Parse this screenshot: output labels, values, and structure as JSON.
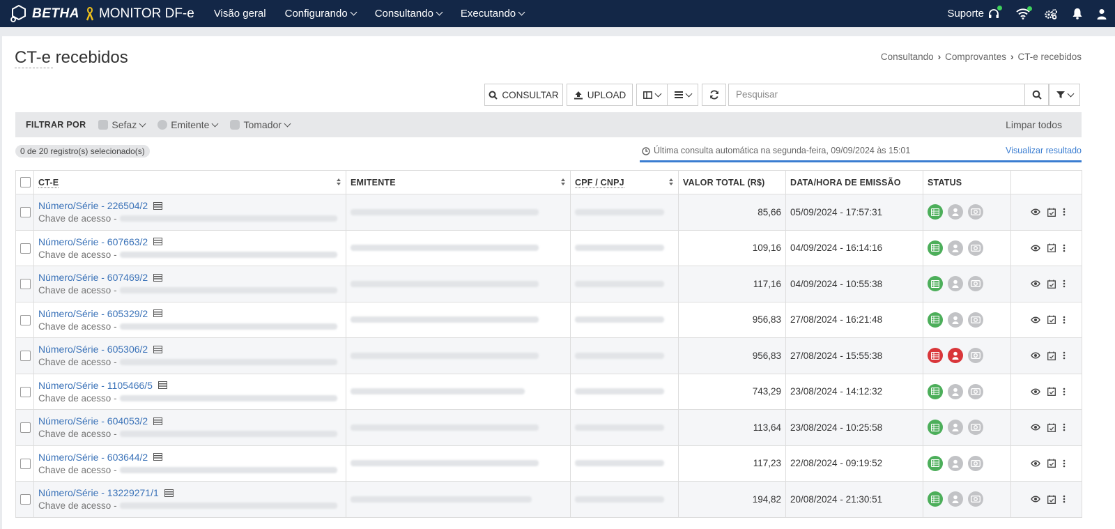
{
  "topbar": {
    "brand": "BETHA",
    "app": "MONITOR DF-e",
    "nav": [
      "Visão geral",
      "Configurando",
      "Consultando",
      "Executando"
    ],
    "support": "Suporte"
  },
  "page": {
    "title": "CT-e recebidos",
    "breadcrumb": [
      "Consultando",
      "Comprovantes",
      "CT-e recebidos"
    ]
  },
  "toolbar": {
    "consultar": "CONSULTAR",
    "upload": "UPLOAD",
    "search_placeholder": "Pesquisar"
  },
  "filters": {
    "label": "FILTRAR POR",
    "items": [
      "Sefaz",
      "Emitente",
      "Tomador"
    ],
    "clear": "Limpar todos"
  },
  "selection": "0 de 20 registro(s) selecionado(s)",
  "last_query": "Última consulta automática na segunda-feira, 09/09/2024 às 15:01",
  "view_result": "Visualizar resultado",
  "table": {
    "headers": [
      "CT-E",
      "EMITENTE",
      "CPF / CNPJ",
      "VALOR TOTAL (R$)",
      "DATA/HORA DE EMISSÃO",
      "STATUS"
    ],
    "chave_label": "Chave de acesso -",
    "rows": [
      {
        "numero": "Número/Série - 226504/2",
        "valor": "85,66",
        "data": "05/09/2024 - 17:57:31",
        "status": [
          "green",
          "grey",
          "grey"
        ]
      },
      {
        "numero": "Número/Série - 607663/2",
        "valor": "109,16",
        "data": "04/09/2024 - 16:14:16",
        "status": [
          "green",
          "grey",
          "grey"
        ]
      },
      {
        "numero": "Número/Série - 607469/2",
        "valor": "117,16",
        "data": "04/09/2024 - 10:55:38",
        "status": [
          "green",
          "grey",
          "grey"
        ]
      },
      {
        "numero": "Número/Série - 605329/2",
        "valor": "956,83",
        "data": "27/08/2024 - 16:21:48",
        "status": [
          "green",
          "grey",
          "grey"
        ]
      },
      {
        "numero": "Número/Série - 605306/2",
        "valor": "956,83",
        "data": "27/08/2024 - 15:55:38",
        "status": [
          "red",
          "red",
          "grey"
        ]
      },
      {
        "numero": "Número/Série - 1105466/5",
        "valor": "743,29",
        "data": "23/08/2024 - 14:12:32",
        "status": [
          "green",
          "grey",
          "grey"
        ]
      },
      {
        "numero": "Número/Série - 604053/2",
        "valor": "113,64",
        "data": "23/08/2024 - 10:25:58",
        "status": [
          "green",
          "grey",
          "grey"
        ]
      },
      {
        "numero": "Número/Série - 603644/2",
        "valor": "117,23",
        "data": "22/08/2024 - 09:19:52",
        "status": [
          "green",
          "grey",
          "grey"
        ]
      },
      {
        "numero": "Número/Série - 13229271/1",
        "valor": "194,82",
        "data": "20/08/2024 - 21:30:51",
        "status": [
          "green",
          "grey",
          "grey"
        ]
      }
    ]
  },
  "colors": {
    "topbar": "#132747",
    "link": "#3a72b8",
    "accent": "#3a7dd1",
    "status_ok": "#4cae5a",
    "status_error": "#d9363a",
    "status_neutral": "#c2c3c6"
  }
}
